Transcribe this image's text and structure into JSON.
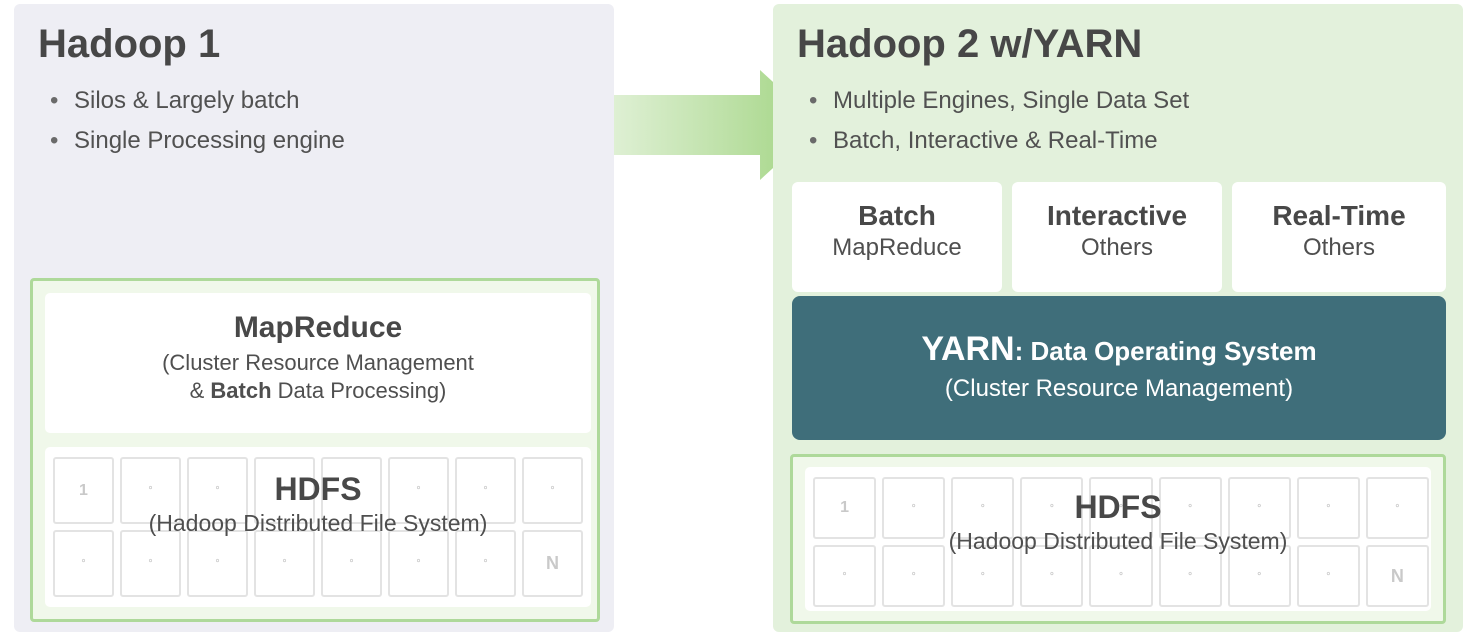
{
  "left": {
    "title": "Hadoop 1",
    "bullets": [
      "Silos & Largely batch",
      "Single Processing engine"
    ],
    "mapreduce": {
      "heading": "MapReduce",
      "sub1": "(Cluster Resource Management",
      "sub2_prefix": "& ",
      "sub2_bold": "Batch",
      "sub2_suffix": " Data Processing)"
    },
    "hdfs": {
      "heading": "HDFS",
      "sub": "(Hadoop Distributed File System)",
      "tiles_row1": [
        "1",
        "°",
        "°",
        "°",
        "°",
        "°",
        "°",
        "°"
      ],
      "tiles_row2": [
        "°",
        "°",
        "°",
        "°",
        "°",
        "°",
        "°",
        "N"
      ]
    }
  },
  "right": {
    "title": "Hadoop 2 w/YARN",
    "bullets": [
      "Multiple Engines, Single Data Set",
      "Batch, Interactive & Real-Time"
    ],
    "engines": [
      {
        "heading": "Batch",
        "sub": "MapReduce"
      },
      {
        "heading": "Interactive",
        "sub": "Others"
      },
      {
        "heading": "Real-Time",
        "sub": "Others"
      }
    ],
    "yarn": {
      "line1_bold": "YARN",
      "line1_rest": ": Data Operating System",
      "line2": "(Cluster Resource Management)"
    },
    "hdfs": {
      "heading": "HDFS",
      "sub": "(Hadoop Distributed File System)",
      "tiles_row1": [
        "1",
        "°",
        "°",
        "°",
        "°",
        "°",
        "°",
        "°",
        "°"
      ],
      "tiles_row2": [
        "°",
        "°",
        "°",
        "°",
        "°",
        "°",
        "°",
        "°",
        "N"
      ]
    }
  }
}
